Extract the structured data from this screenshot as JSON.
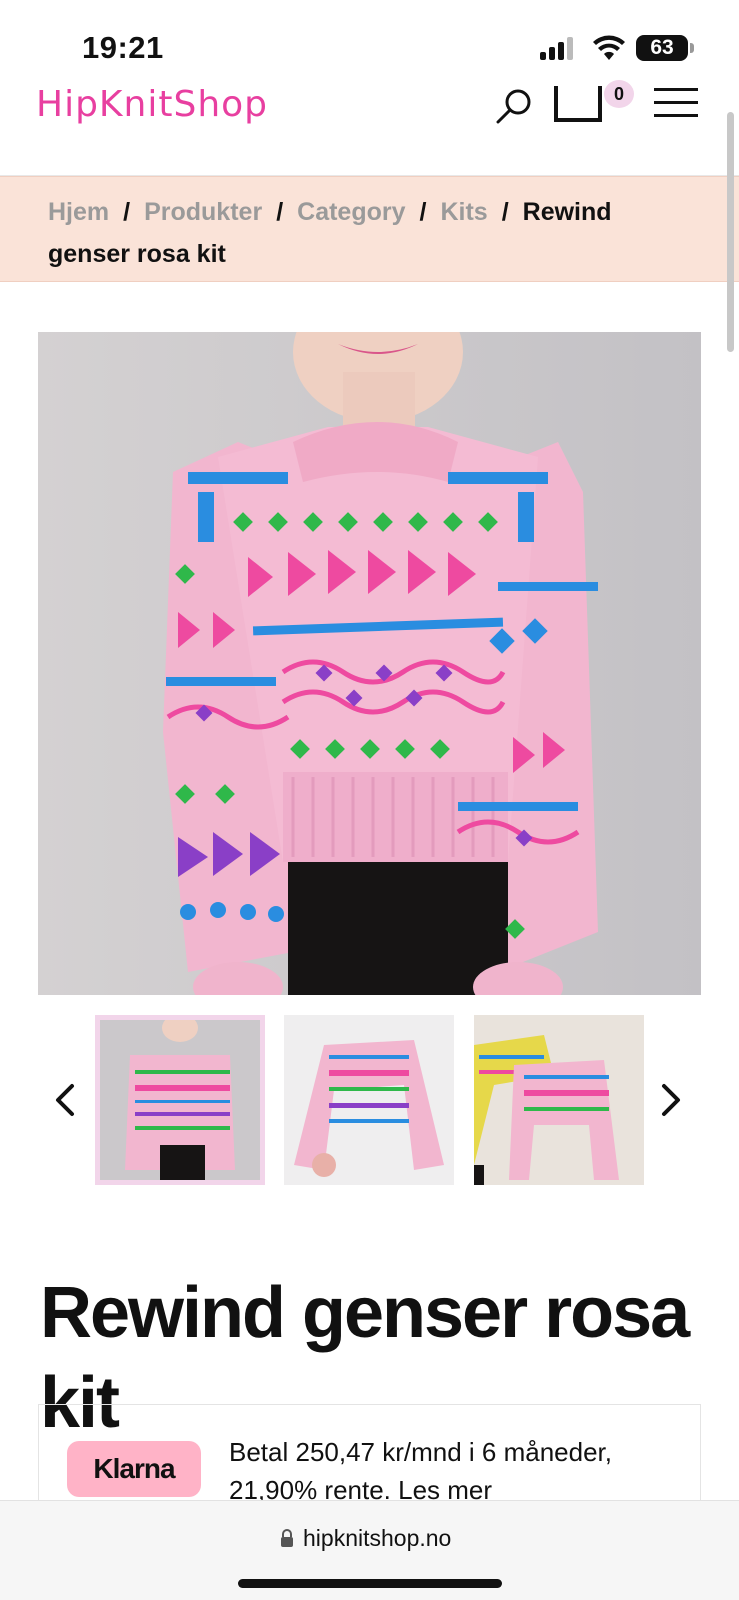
{
  "status_bar": {
    "time": "19:21",
    "battery": "63"
  },
  "header": {
    "logo": "HipKnitShop",
    "cart_count": "0"
  },
  "breadcrumb": {
    "items": [
      "Hjem",
      "Produkter",
      "Category",
      "Kits"
    ],
    "separator": "/",
    "current": "Rewind genser rosa kit"
  },
  "product": {
    "title": "Rewind genser rosa kit"
  },
  "klarna": {
    "badge": "Klarna",
    "text": "Betal 250,47 kr/mnd i 6 måneder, 21,90% rente.",
    "link": "Les mer"
  },
  "browser": {
    "url": "hipknitshop.no"
  },
  "colors": {
    "brand": "#e83fa0",
    "breadcrumb_bg": "#fae3d8",
    "klarna_pink": "#ffb3c7",
    "sweater_pink": "#f2b6cf",
    "pattern_blue": "#2a8de0",
    "pattern_green": "#2fb84a",
    "pattern_magenta": "#ee4aa0",
    "pattern_purple": "#8a3fc7"
  }
}
